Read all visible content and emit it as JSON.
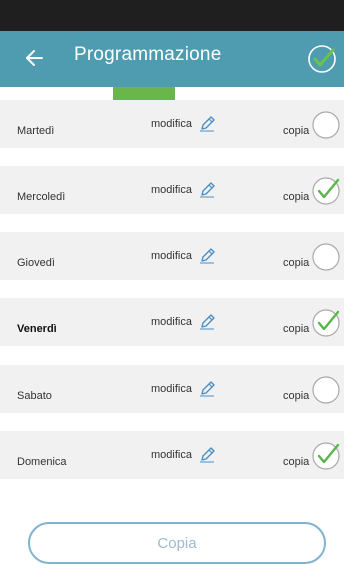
{
  "header": {
    "title": "Programmazione"
  },
  "days": [
    {
      "name": "Martedì",
      "edit": "modifica",
      "copy": "copia",
      "checked": false,
      "bold": false
    },
    {
      "name": "Mercoledì",
      "edit": "modifica",
      "copy": "copia",
      "checked": true,
      "bold": false
    },
    {
      "name": "Giovedì",
      "edit": "modifica",
      "copy": "copia",
      "checked": false,
      "bold": false
    },
    {
      "name": "Venerdì",
      "edit": "modifica",
      "copy": "copia",
      "checked": true,
      "bold": true
    },
    {
      "name": "Sabato",
      "edit": "modifica",
      "copy": "copia",
      "checked": false,
      "bold": false
    },
    {
      "name": "Domenica",
      "edit": "modifica",
      "copy": "copia",
      "checked": true,
      "bold": false
    }
  ],
  "footer": {
    "copy_button": "Copia"
  },
  "colors": {
    "app_bar": "#4f9bb0",
    "accent_green": "#6bb64a",
    "check_green": "#58b64c",
    "button_border": "#7fb3cf"
  },
  "icons": {
    "back": "arrow-left-icon",
    "confirm": "check-circle-icon",
    "edit": "pencil-icon",
    "copy_toggle": "check-circle-icon"
  }
}
